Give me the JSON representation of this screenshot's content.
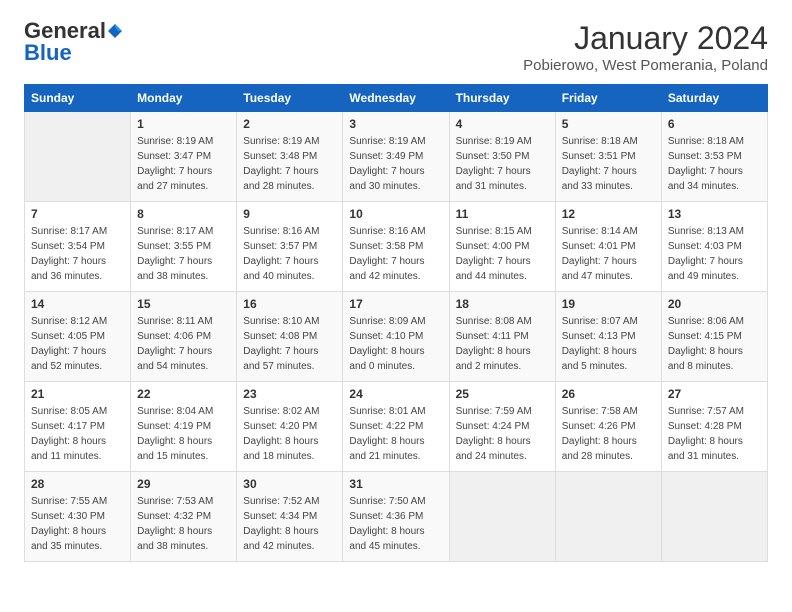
{
  "header": {
    "logo_general": "General",
    "logo_blue": "Blue",
    "month": "January 2024",
    "location": "Pobierowo, West Pomerania, Poland"
  },
  "days_of_week": [
    "Sunday",
    "Monday",
    "Tuesday",
    "Wednesday",
    "Thursday",
    "Friday",
    "Saturday"
  ],
  "weeks": [
    [
      {
        "day": "",
        "empty": true
      },
      {
        "day": "1",
        "sunrise": "8:19 AM",
        "sunset": "3:47 PM",
        "daylight": "7 hours and 27 minutes."
      },
      {
        "day": "2",
        "sunrise": "8:19 AM",
        "sunset": "3:48 PM",
        "daylight": "7 hours and 28 minutes."
      },
      {
        "day": "3",
        "sunrise": "8:19 AM",
        "sunset": "3:49 PM",
        "daylight": "7 hours and 30 minutes."
      },
      {
        "day": "4",
        "sunrise": "8:19 AM",
        "sunset": "3:50 PM",
        "daylight": "7 hours and 31 minutes."
      },
      {
        "day": "5",
        "sunrise": "8:18 AM",
        "sunset": "3:51 PM",
        "daylight": "7 hours and 33 minutes."
      },
      {
        "day": "6",
        "sunrise": "8:18 AM",
        "sunset": "3:53 PM",
        "daylight": "7 hours and 34 minutes."
      }
    ],
    [
      {
        "day": "7",
        "sunrise": "8:17 AM",
        "sunset": "3:54 PM",
        "daylight": "7 hours and 36 minutes."
      },
      {
        "day": "8",
        "sunrise": "8:17 AM",
        "sunset": "3:55 PM",
        "daylight": "7 hours and 38 minutes."
      },
      {
        "day": "9",
        "sunrise": "8:16 AM",
        "sunset": "3:57 PM",
        "daylight": "7 hours and 40 minutes."
      },
      {
        "day": "10",
        "sunrise": "8:16 AM",
        "sunset": "3:58 PM",
        "daylight": "7 hours and 42 minutes."
      },
      {
        "day": "11",
        "sunrise": "8:15 AM",
        "sunset": "4:00 PM",
        "daylight": "7 hours and 44 minutes."
      },
      {
        "day": "12",
        "sunrise": "8:14 AM",
        "sunset": "4:01 PM",
        "daylight": "7 hours and 47 minutes."
      },
      {
        "day": "13",
        "sunrise": "8:13 AM",
        "sunset": "4:03 PM",
        "daylight": "7 hours and 49 minutes."
      }
    ],
    [
      {
        "day": "14",
        "sunrise": "8:12 AM",
        "sunset": "4:05 PM",
        "daylight": "7 hours and 52 minutes."
      },
      {
        "day": "15",
        "sunrise": "8:11 AM",
        "sunset": "4:06 PM",
        "daylight": "7 hours and 54 minutes."
      },
      {
        "day": "16",
        "sunrise": "8:10 AM",
        "sunset": "4:08 PM",
        "daylight": "7 hours and 57 minutes."
      },
      {
        "day": "17",
        "sunrise": "8:09 AM",
        "sunset": "4:10 PM",
        "daylight": "8 hours and 0 minutes."
      },
      {
        "day": "18",
        "sunrise": "8:08 AM",
        "sunset": "4:11 PM",
        "daylight": "8 hours and 2 minutes."
      },
      {
        "day": "19",
        "sunrise": "8:07 AM",
        "sunset": "4:13 PM",
        "daylight": "8 hours and 5 minutes."
      },
      {
        "day": "20",
        "sunrise": "8:06 AM",
        "sunset": "4:15 PM",
        "daylight": "8 hours and 8 minutes."
      }
    ],
    [
      {
        "day": "21",
        "sunrise": "8:05 AM",
        "sunset": "4:17 PM",
        "daylight": "8 hours and 11 minutes."
      },
      {
        "day": "22",
        "sunrise": "8:04 AM",
        "sunset": "4:19 PM",
        "daylight": "8 hours and 15 minutes."
      },
      {
        "day": "23",
        "sunrise": "8:02 AM",
        "sunset": "4:20 PM",
        "daylight": "8 hours and 18 minutes."
      },
      {
        "day": "24",
        "sunrise": "8:01 AM",
        "sunset": "4:22 PM",
        "daylight": "8 hours and 21 minutes."
      },
      {
        "day": "25",
        "sunrise": "7:59 AM",
        "sunset": "4:24 PM",
        "daylight": "8 hours and 24 minutes."
      },
      {
        "day": "26",
        "sunrise": "7:58 AM",
        "sunset": "4:26 PM",
        "daylight": "8 hours and 28 minutes."
      },
      {
        "day": "27",
        "sunrise": "7:57 AM",
        "sunset": "4:28 PM",
        "daylight": "8 hours and 31 minutes."
      }
    ],
    [
      {
        "day": "28",
        "sunrise": "7:55 AM",
        "sunset": "4:30 PM",
        "daylight": "8 hours and 35 minutes."
      },
      {
        "day": "29",
        "sunrise": "7:53 AM",
        "sunset": "4:32 PM",
        "daylight": "8 hours and 38 minutes."
      },
      {
        "day": "30",
        "sunrise": "7:52 AM",
        "sunset": "4:34 PM",
        "daylight": "8 hours and 42 minutes."
      },
      {
        "day": "31",
        "sunrise": "7:50 AM",
        "sunset": "4:36 PM",
        "daylight": "8 hours and 45 minutes."
      },
      {
        "day": "",
        "empty": true
      },
      {
        "day": "",
        "empty": true
      },
      {
        "day": "",
        "empty": true
      }
    ]
  ]
}
